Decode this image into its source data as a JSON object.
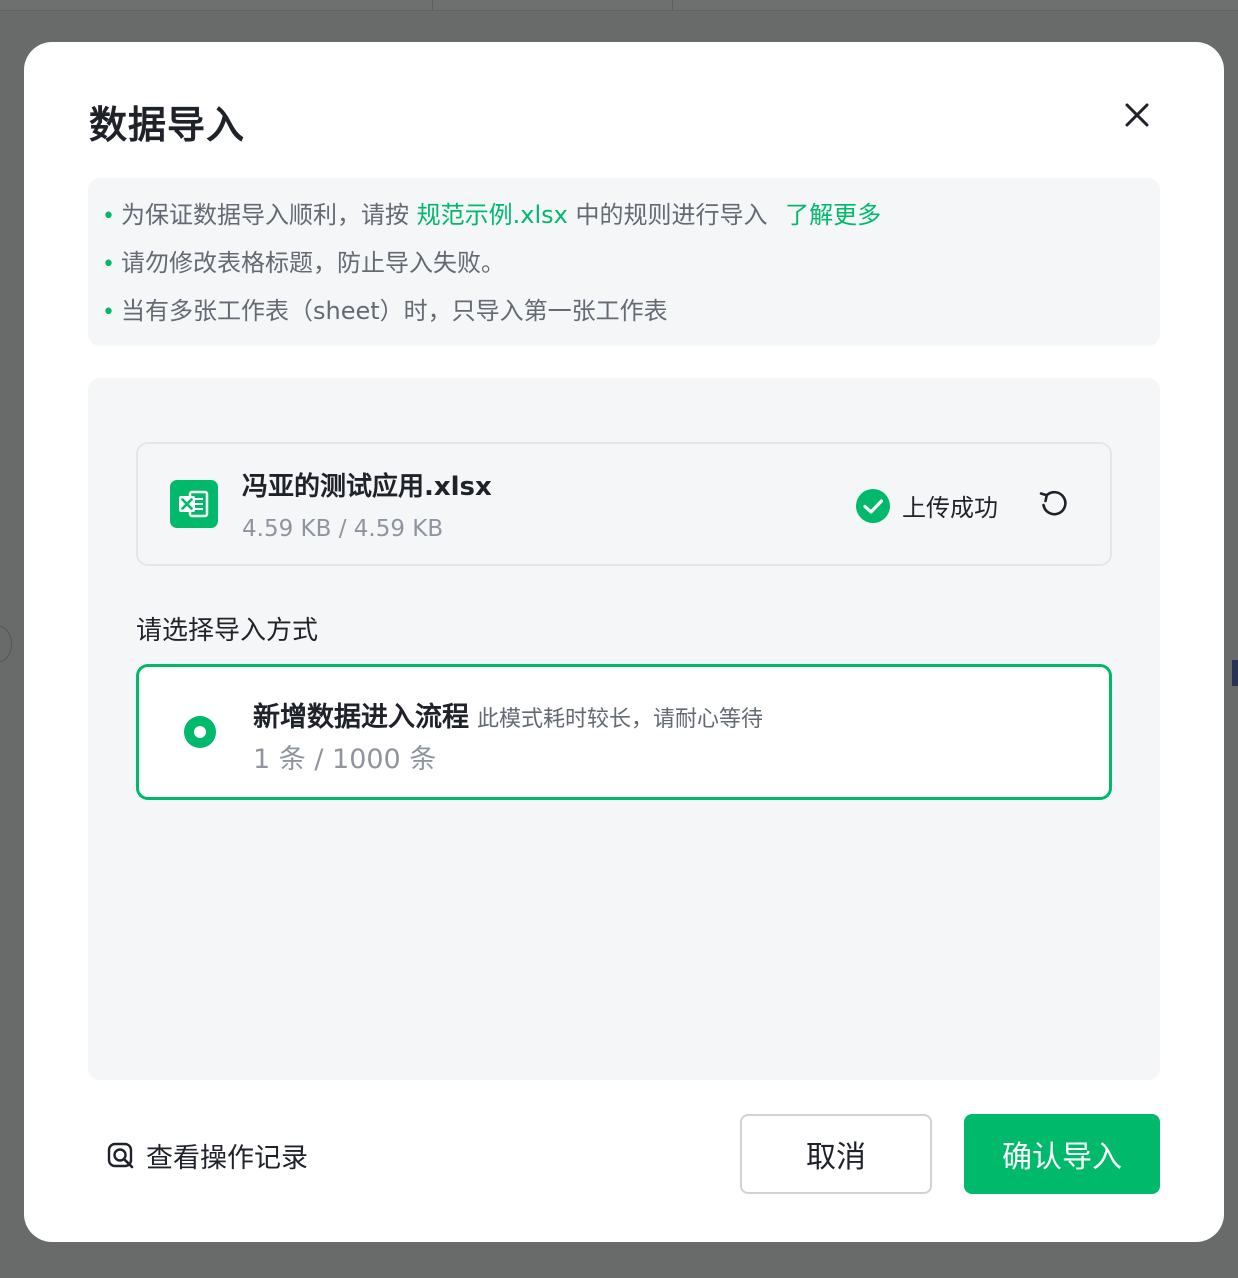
{
  "dialog": {
    "title": "数据导入",
    "close_label": "close"
  },
  "notice": {
    "line1_prefix": "为保证数据导入顺利，请按",
    "line1_link": "规范示例.xlsx",
    "line1_suffix": "中的规则进行导入",
    "learn_more": "了解更多",
    "line2": "请勿修改表格标题，防止导入失败。",
    "line3": "当有多张工作表（sheet）时，只导入第一张工作表"
  },
  "file": {
    "name": "冯亚的测试应用.xlsx",
    "size": "4.59 KB / 4.59 KB",
    "status": "上传成功",
    "icon": "excel-file-icon"
  },
  "import_mode": {
    "label": "请选择导入方式",
    "option": {
      "title": "新增数据进入流程",
      "hint": "此模式耗时较长，请耐心等待",
      "count": "1 条 / 1000 条",
      "selected": true
    }
  },
  "footer": {
    "history_label": "查看操作记录",
    "cancel_label": "取消",
    "confirm_label": "确认导入"
  },
  "colors": {
    "accent": "#00b96b",
    "text_primary": "#1f2329",
    "text_secondary": "#646a73",
    "panel_bg": "#f5f6f8"
  }
}
